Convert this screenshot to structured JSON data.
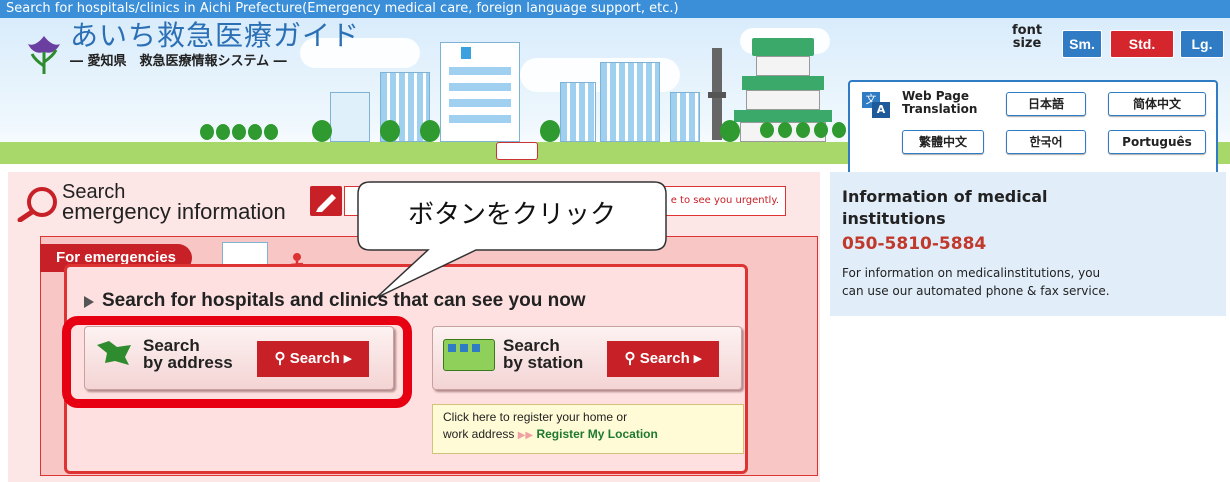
{
  "top_bar": {
    "text": "Search for hospitals/clinics in Aichi Prefecture(Emergency medical care, foreign language support, etc.)"
  },
  "logo": {
    "title": "あいち救急医療ガイド",
    "subtitle": "― 愛知県　救急医療情報システム ―"
  },
  "font_size": {
    "label_line1": "font",
    "label_line2": "size",
    "small": "Sm.",
    "standard": "Std.",
    "large": "Lg."
  },
  "translation": {
    "label_line1": "Web Page",
    "label_line2": "Translation",
    "languages": [
      "日本語",
      "简体中文",
      "繁體中文",
      "한국어",
      "Português"
    ]
  },
  "search_section": {
    "title_line1": "Search",
    "title_line2": "emergency information",
    "notice_tail": "e to see you urgently."
  },
  "emergency": {
    "tab_label": "For emergencies",
    "heading": "Search for hospitals and clinics that can see you now",
    "by_address_line1": "Search",
    "by_address_line2": "by address",
    "by_station_line1": "Search",
    "by_station_line2": "by station",
    "search_label": "Search",
    "register_line1": "Click here to register your home or",
    "register_line2": "work address",
    "register_link": "Register My Location"
  },
  "callout": {
    "text": "ボタンをクリック"
  },
  "info": {
    "title_line1": "Information of medical",
    "title_line2": "institutions",
    "phone": "050-5810-5884",
    "desc_line1": "For information on medicalinstitutions, you",
    "desc_line2": "can use our automated phone & fax service."
  },
  "colors": {
    "accent_blue": "#2f7cc4",
    "emergency_red": "#c82027",
    "highlight_red": "#e60012",
    "phone_red": "#c0392b"
  },
  "icons": [
    "iris-logo-icon",
    "magnifier-icon",
    "pencil-icon",
    "translate-icon",
    "frog-icon",
    "train-icon",
    "search-icon",
    "arrow-right-icon"
  ]
}
